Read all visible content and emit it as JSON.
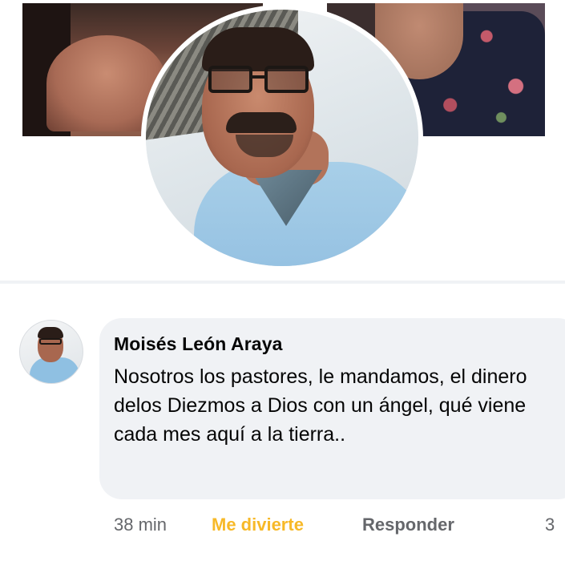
{
  "comment": {
    "author": "Moisés León Araya",
    "text": "Nosotros los pastores, le mandamos, el dinero delos Diezmos a Dios con un ángel, qué viene cada mes aquí a la tierra..",
    "time": "38 min",
    "reaction_label": "Me divierte",
    "reply_label": "Responder",
    "reaction_count": "3"
  },
  "colors": {
    "reaction": "#f7b928",
    "secondary_text": "#65676b",
    "bubble": "#f0f2f5"
  }
}
